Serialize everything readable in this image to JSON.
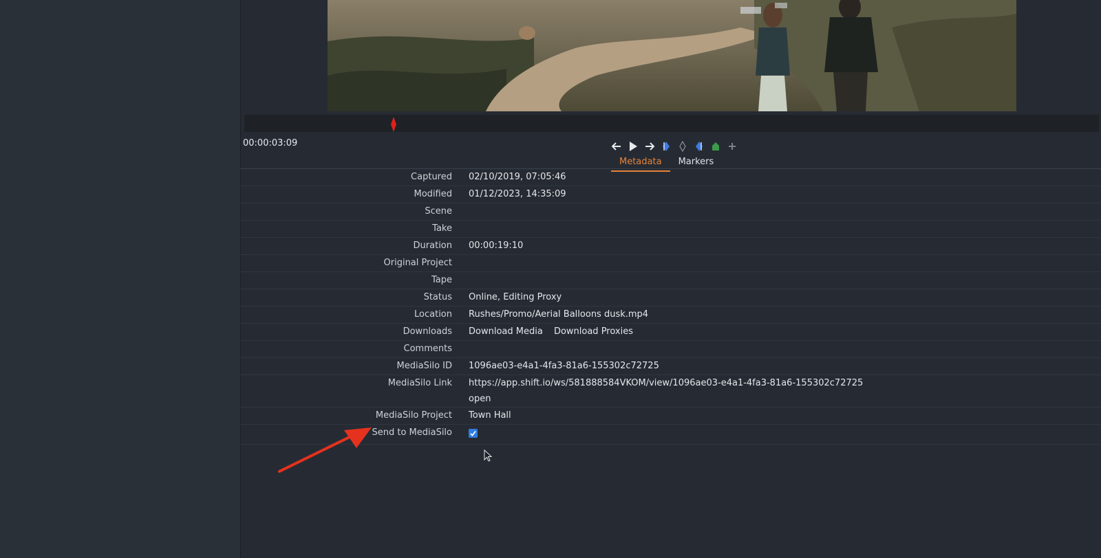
{
  "timecode": "00:00:03:09",
  "tabs": {
    "metadata": "Metadata",
    "markers": "Markers"
  },
  "fields": {
    "captured": {
      "label": "Captured",
      "value": "02/10/2019, 07:05:46"
    },
    "modified": {
      "label": "Modified",
      "value": "01/12/2023, 14:35:09"
    },
    "scene": {
      "label": "Scene",
      "value": ""
    },
    "take": {
      "label": "Take",
      "value": ""
    },
    "duration": {
      "label": "Duration",
      "value": "00:00:19:10"
    },
    "original_project": {
      "label": "Original Project",
      "value": ""
    },
    "tape": {
      "label": "Tape",
      "value": ""
    },
    "status": {
      "label": "Status",
      "value": "Online, Editing Proxy"
    },
    "location": {
      "label": "Location",
      "value": "Rushes/Promo/Aerial Balloons dusk.mp4"
    },
    "downloads": {
      "label": "Downloads",
      "media": "Download Media",
      "proxies": "Download Proxies"
    },
    "comments": {
      "label": "Comments",
      "value": ""
    },
    "mediasilo_id": {
      "label": "MediaSilo ID",
      "value": "1096ae03-e4a1-4fa3-81a6-155302c72725"
    },
    "mediasilo_link": {
      "label": "MediaSilo Link",
      "value": "https://app.shift.io/ws/581888584VKOM/view/1096ae03-e4a1-4fa3-81a6-155302c72725",
      "open": "open"
    },
    "mediasilo_project": {
      "label": "MediaSilo Project",
      "value": "Town Hall"
    },
    "send_to_mediasilo": {
      "label": "Send to MediaSilo",
      "checked": true
    }
  },
  "colors": {
    "accent": "#e8833a",
    "playhead": "#e0201a",
    "checkbox": "#2f7de1",
    "arrow": "#e5321f"
  },
  "icons": [
    "arrow-left-icon",
    "play-icon",
    "arrow-right-icon",
    "mark-in-icon",
    "marker-icon",
    "mark-out-icon",
    "home-marker-icon",
    "add-icon"
  ]
}
